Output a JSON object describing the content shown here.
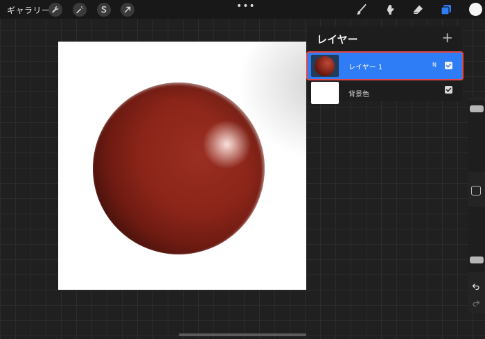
{
  "topbar": {
    "gallery_label": "ギャラリー",
    "left_tools": [
      "wrench-icon",
      "magic-wand-icon",
      "selection-icon",
      "transform-arrow-icon"
    ],
    "more_label": "•••",
    "right_tools": [
      "brush-icon",
      "smudge-icon",
      "eraser-icon",
      "layers-icon"
    ],
    "active_tool": "layers-icon",
    "active_color": "#f5f5f5",
    "accent": "#2f7df6"
  },
  "canvas": {
    "background": "#ffffff",
    "sphere_color": "#8c2519"
  },
  "layers_panel": {
    "title": "レイヤー",
    "add_label": "+",
    "layers": [
      {
        "name": "レイヤー 1",
        "blend_mode": "N",
        "visible": true,
        "selected": true
      },
      {
        "name": "背景色",
        "visible": true,
        "selected": false
      }
    ]
  },
  "sidebar": {
    "tools": [
      "brush-size-slider",
      "modify-button",
      "opacity-slider",
      "undo-icon",
      "redo-icon"
    ]
  }
}
